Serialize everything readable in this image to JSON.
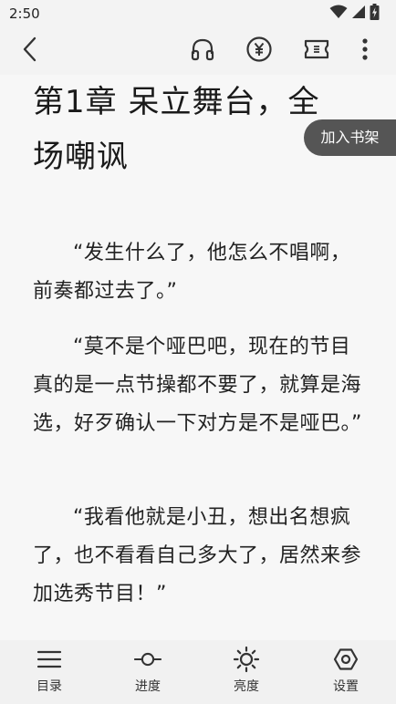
{
  "status_bar": {
    "time": "2:50",
    "icons": [
      "wifi-icon",
      "signal-icon",
      "battery-icon"
    ]
  },
  "top_bar": {
    "icons": [
      "back-icon",
      "headphones-icon",
      "yuan-coin-icon",
      "ticket-icon",
      "more-vert-icon"
    ]
  },
  "chapter": {
    "title": "第1章  呆立舞台，全场嘲讽",
    "add_to_shelf_label": "加入书架",
    "paragraphs": [
      "“发生什么了，他怎么不唱啊，前奏都过去了。”",
      "“莫不是个哑巴吧，现在的节目真的是一点节操都不要了，就算是海选，好歹确认一下对方是不是哑巴。”",
      "“我看他就是小丑，想出名想疯了，也不看看自己多大了，居然来参加选秀节目！”"
    ]
  },
  "bottom_nav": {
    "items": [
      {
        "label": "目录",
        "icon": "menu-icon"
      },
      {
        "label": "进度",
        "icon": "progress-icon"
      },
      {
        "label": "亮度",
        "icon": "brightness-icon"
      },
      {
        "label": "设置",
        "icon": "settings-icon"
      }
    ]
  },
  "colors": {
    "background": "#f7f7f7",
    "bar_background": "#f3f3f3",
    "shelf_button": "#555555",
    "text": "#222222"
  }
}
